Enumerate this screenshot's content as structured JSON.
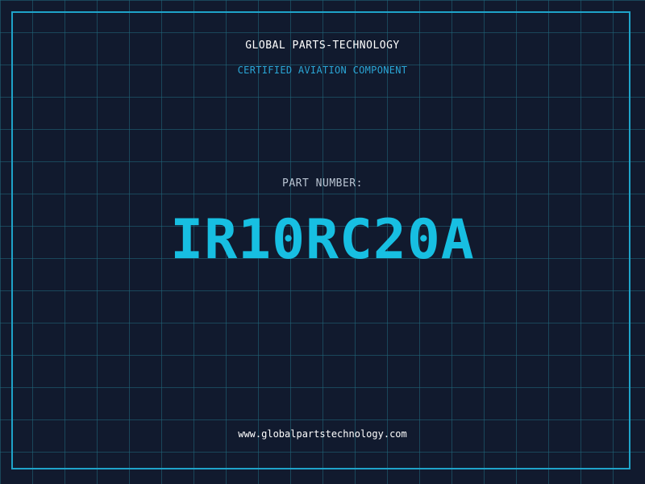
{
  "header": {
    "company_name": "GLOBAL PARTS-TECHNOLOGY",
    "subtitle": "CERTIFIED AVIATION COMPONENT"
  },
  "part": {
    "label": "PART NUMBER:",
    "number": "IR10RC20A"
  },
  "footer": {
    "website": "www.globalpartstechnology.com"
  },
  "colors": {
    "background": "#111a2e",
    "grid": "#20697d",
    "accent": "#17bfe2",
    "frame": "#1fa3c9",
    "subtitle": "#2aa6d6",
    "text": "#ffffff"
  }
}
